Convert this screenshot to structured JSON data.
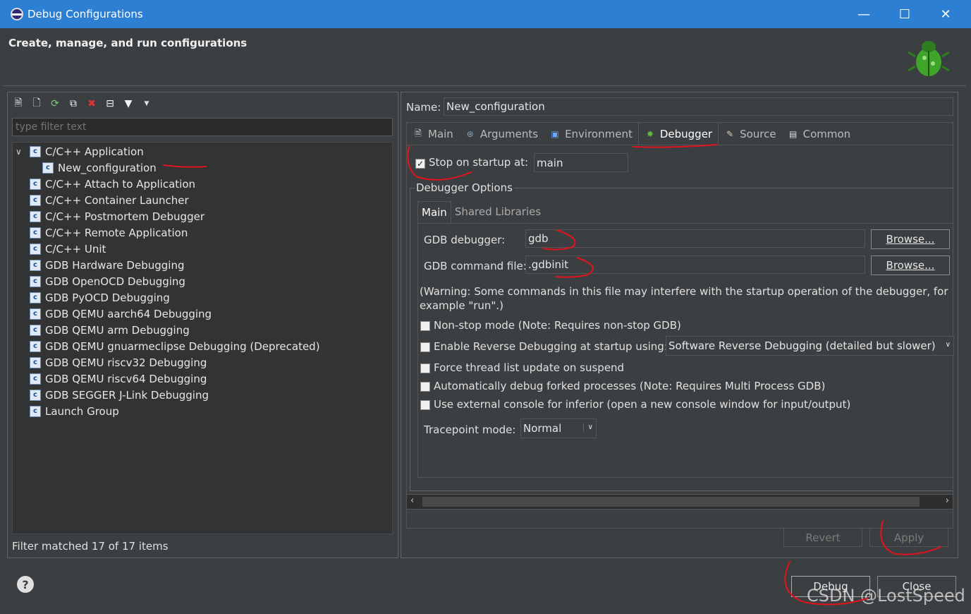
{
  "window": {
    "title": "Debug Configurations",
    "min": "—",
    "max": "☐",
    "close": "✕"
  },
  "header": {
    "title": "Create, manage, and run configurations"
  },
  "left": {
    "filter_placeholder": "type filter text",
    "tree": [
      {
        "label": "C/C++ Application",
        "expanded": true
      },
      {
        "label": "New_configuration",
        "child": true
      },
      {
        "label": "C/C++ Attach to Application"
      },
      {
        "label": "C/C++ Container Launcher"
      },
      {
        "label": "C/C++ Postmortem Debugger"
      },
      {
        "label": "C/C++ Remote Application"
      },
      {
        "label": "C/C++ Unit"
      },
      {
        "label": "GDB Hardware Debugging"
      },
      {
        "label": "GDB OpenOCD Debugging"
      },
      {
        "label": "GDB PyOCD Debugging"
      },
      {
        "label": "GDB QEMU aarch64 Debugging"
      },
      {
        "label": "GDB QEMU arm Debugging"
      },
      {
        "label": "GDB QEMU gnuarmeclipse Debugging (Deprecated)"
      },
      {
        "label": "GDB QEMU riscv32 Debugging"
      },
      {
        "label": "GDB QEMU riscv64 Debugging"
      },
      {
        "label": "GDB SEGGER J-Link Debugging"
      },
      {
        "label": "Launch Group"
      }
    ],
    "status": "Filter matched 17 of 17 items"
  },
  "right": {
    "name_label": "Name:",
    "name_value": "New_configuration",
    "tabs": [
      "Main",
      "Arguments",
      "Environment",
      "Debugger",
      "Source",
      "Common"
    ],
    "active_tab": "Debugger",
    "stop_on_startup_label": "Stop on startup at:",
    "stop_on_startup_checked": true,
    "stop_on_startup_value": "main",
    "debugger_options_label": "Debugger Options",
    "inner_tabs": [
      "Main",
      "Shared Libraries"
    ],
    "gdb_debugger_label": "GDB debugger:",
    "gdb_debugger_value": "gdb",
    "gdb_command_file_label": "GDB command file:",
    "gdb_command_file_value": ".gdbinit",
    "browse_label": "Browse...",
    "warning": "(Warning: Some commands in this file may interfere with the startup operation of the debugger, for example \"run\".)",
    "options": [
      "Non-stop mode (Note: Requires non-stop GDB)",
      "Enable Reverse Debugging at startup using:",
      "Force thread list update on suspend",
      "Automatically debug forked processes (Note: Requires Multi Process GDB)",
      "Use external console for inferior (open a new console window for input/output)"
    ],
    "reverse_debug_select": "Software Reverse Debugging (detailed but slower)",
    "tracepoint_label": "Tracepoint mode:",
    "tracepoint_value": "Normal",
    "revert_label": "Revert",
    "apply_label": "Apply"
  },
  "footer": {
    "debug_label": "Debug",
    "close_label": "Close",
    "help": "?"
  },
  "watermark": "CSDN @LostSpeed",
  "colors": {
    "titlebar": "#2d7fd3",
    "annotation": "#e0141e"
  }
}
